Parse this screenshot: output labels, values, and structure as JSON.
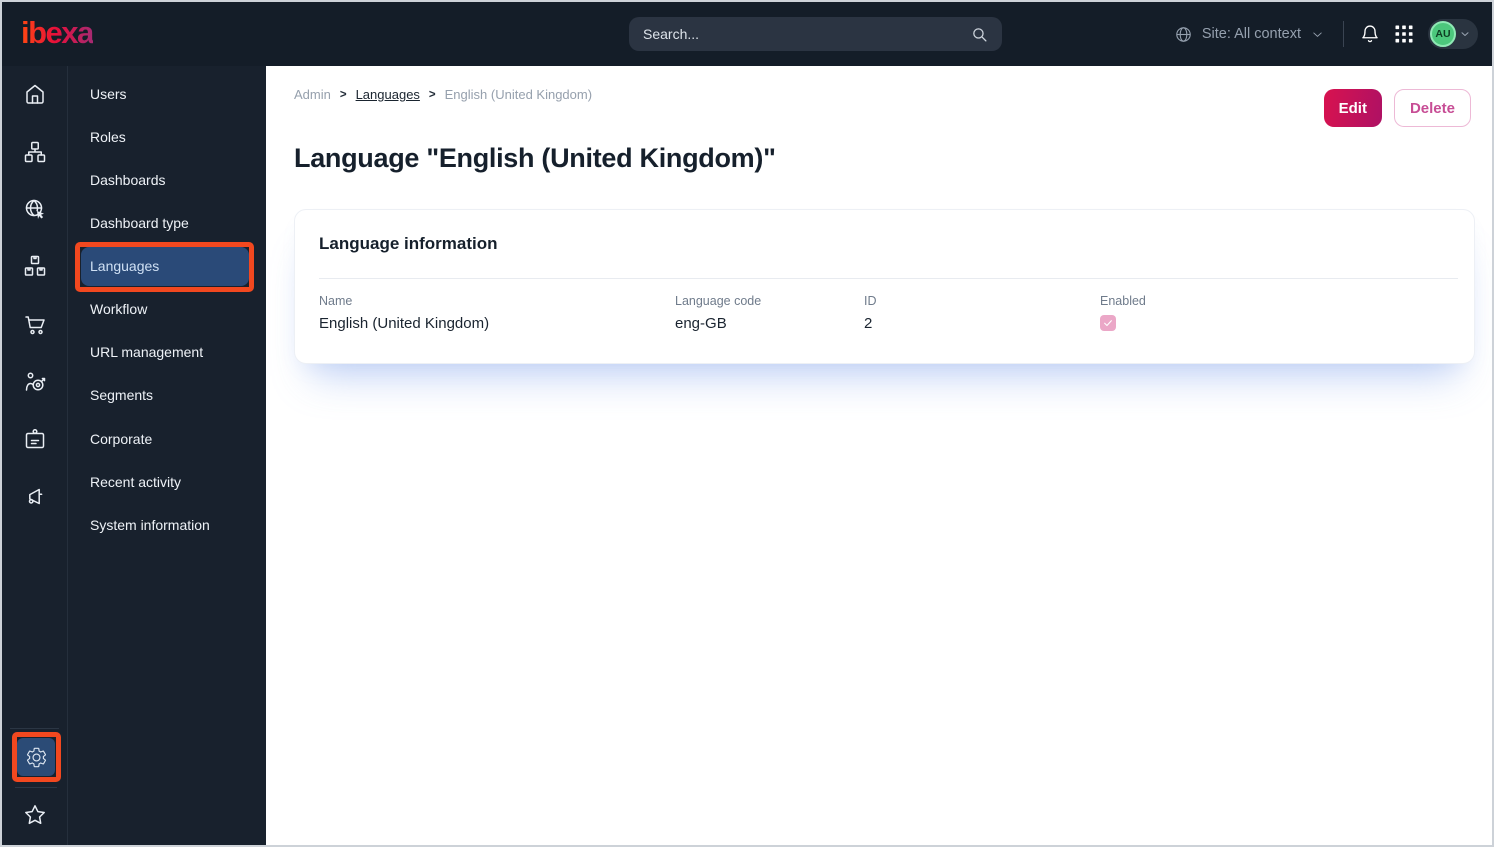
{
  "colors": {
    "accent_pink": "#d8124f",
    "edit_gradient_end": "#ae1164",
    "annotation_orange": "#f2481f",
    "active_item_blue": "#2a4a78",
    "avatar_green": "#4cc77c",
    "checkbox_pink": "#eba7c7",
    "topbar_bg": "#141d28",
    "sidebar_bg": "#18212d"
  },
  "topbar": {
    "logo_text": "ibexa",
    "search": {
      "placeholder": "Search...",
      "icon": "search-icon"
    },
    "site_selector": {
      "label": "Site: All context",
      "left_icon": "globe-icon",
      "right_icon": "chevron-down-icon"
    },
    "icons": [
      "bell-icon",
      "app-grid-icon"
    ],
    "user_menu": {
      "initials": "AU",
      "icon": "chevron-down-icon"
    }
  },
  "rail": {
    "items": [
      {
        "icon": "home-icon"
      },
      {
        "icon": "content-tree-icon"
      },
      {
        "icon": "site-globe-cursor-icon"
      },
      {
        "icon": "products-boxes-icon"
      },
      {
        "icon": "commerce-cart-icon"
      },
      {
        "icon": "personalization-target-icon"
      },
      {
        "icon": "corporate-badge-icon"
      },
      {
        "icon": "megaphone-icon"
      }
    ],
    "bottom_items": [
      {
        "icon": "gear-icon",
        "active": true
      },
      {
        "icon": "star-icon"
      }
    ]
  },
  "sidebar": {
    "items": [
      {
        "label": "Users"
      },
      {
        "label": "Roles"
      },
      {
        "label": "Dashboards"
      },
      {
        "label": "Dashboard type"
      },
      {
        "label": "Languages",
        "active": true
      },
      {
        "label": "Workflow"
      },
      {
        "label": "URL management"
      },
      {
        "label": "Segments"
      },
      {
        "label": "Corporate"
      },
      {
        "label": "Recent activity"
      },
      {
        "label": "System information"
      }
    ]
  },
  "breadcrumb": {
    "items": [
      "Admin",
      "Languages",
      "English (United Kingdom)"
    ],
    "separator": ">"
  },
  "actions": {
    "edit_label": "Edit",
    "delete_label": "Delete"
  },
  "page": {
    "title": "Language \"English (United Kingdom)\""
  },
  "card": {
    "heading": "Language information",
    "fields": [
      {
        "label": "Name",
        "value": "English (United Kingdom)"
      },
      {
        "label": "Language code",
        "value": "eng-GB"
      },
      {
        "label": "ID",
        "value": "2"
      },
      {
        "label": "Enabled",
        "type": "checkbox",
        "checked": true
      }
    ]
  }
}
